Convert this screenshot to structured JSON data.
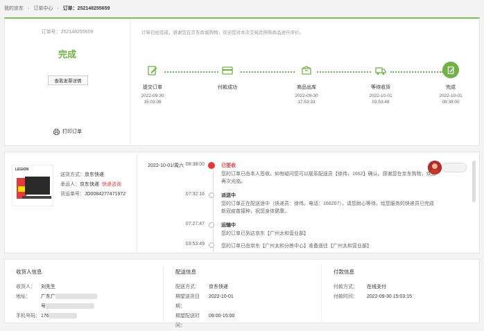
{
  "breadcrumb": {
    "home": "我的京东",
    "center": "订单中心",
    "order": "订单：252148255659"
  },
  "status": {
    "order_no": "订单号：252148255659",
    "state": "完成",
    "invoice_btn": "查看发票详情",
    "print": "打印订单",
    "tip": "订单已经完成，感谢您在京东商城购物，欢迎您对本次交易及所购商品进行评价。"
  },
  "steps": [
    {
      "name": "提交订单",
      "date": "2022-09-30",
      "time": "15:03:08",
      "icon": "edit-icon"
    },
    {
      "name": "付款成功",
      "date": "",
      "time": "",
      "icon": "card-icon"
    },
    {
      "name": "商品出库",
      "date": "2022-09-30",
      "time": "17:53:33",
      "icon": "box-icon"
    },
    {
      "name": "等待收货",
      "date": "2022-10-01",
      "time": "03:53:49",
      "icon": "truck-icon"
    },
    {
      "name": "完成",
      "date": "2022-10-01",
      "time": "08:38:00",
      "icon": "check-doc-icon"
    }
  ],
  "shipping": {
    "method_k": "送货方式：",
    "method_v": "京东快递",
    "carrier_k": "承运人：",
    "carrier_v": "京东快递",
    "carrier_link": "快递咨询",
    "waybill_k": "货运单号：",
    "waybill_v": "JD0084277471972",
    "product_brand": "LEGION"
  },
  "tracking": [
    {
      "date": "2022-10-01/周六",
      "time": "08:38:00",
      "title": "已签收",
      "text": "您的订单已由本人签收。如有疑问您可以联系配送员【徐伟，1662】确认。感谢您在京东购物，欢迎再次光临。"
    },
    {
      "date": "",
      "time": "07:32:16",
      "title": "派送中",
      "text": "您的订单正在配送途中（快递员：徐伟，电话：166207），请您耐心等待。给您服务的快递员已完成新冠疫苗接种，祝您身体健康。"
    },
    {
      "date": "",
      "time": "07:27:47",
      "title": "运输中",
      "text": "您的订单已到达京东【广州太和营业部】"
    },
    {
      "date": "",
      "time": "03:53:49",
      "title": "",
      "text": "您的订单已由京东【广州太和分拣中心】准备送往【广州太和营业部】"
    }
  ],
  "receiver": {
    "title": "收货人信息",
    "name_k": "收货人：",
    "name_v": "刘先生",
    "addr_k": "地址：",
    "addr_v1": "广东广",
    "addr_v2": "号",
    "phone_k": "手机号码：",
    "phone_v": "176"
  },
  "delivery": {
    "title": "配送信息",
    "method_k": "配送方式：",
    "method_v": "京东快递",
    "date_k": "期望送货日期：",
    "date_v": "2022-10-01",
    "time_k": "期望配送时间：",
    "time_v": "09:00-15:00"
  },
  "payment": {
    "title": "付款信息",
    "method_k": "付款方式：",
    "method_v": "在线支付",
    "time_k": "付款时间：",
    "time_v": "2022-09-30 15:03:15"
  },
  "colors": {
    "accent": "#71b247",
    "red": "#e4393c"
  }
}
